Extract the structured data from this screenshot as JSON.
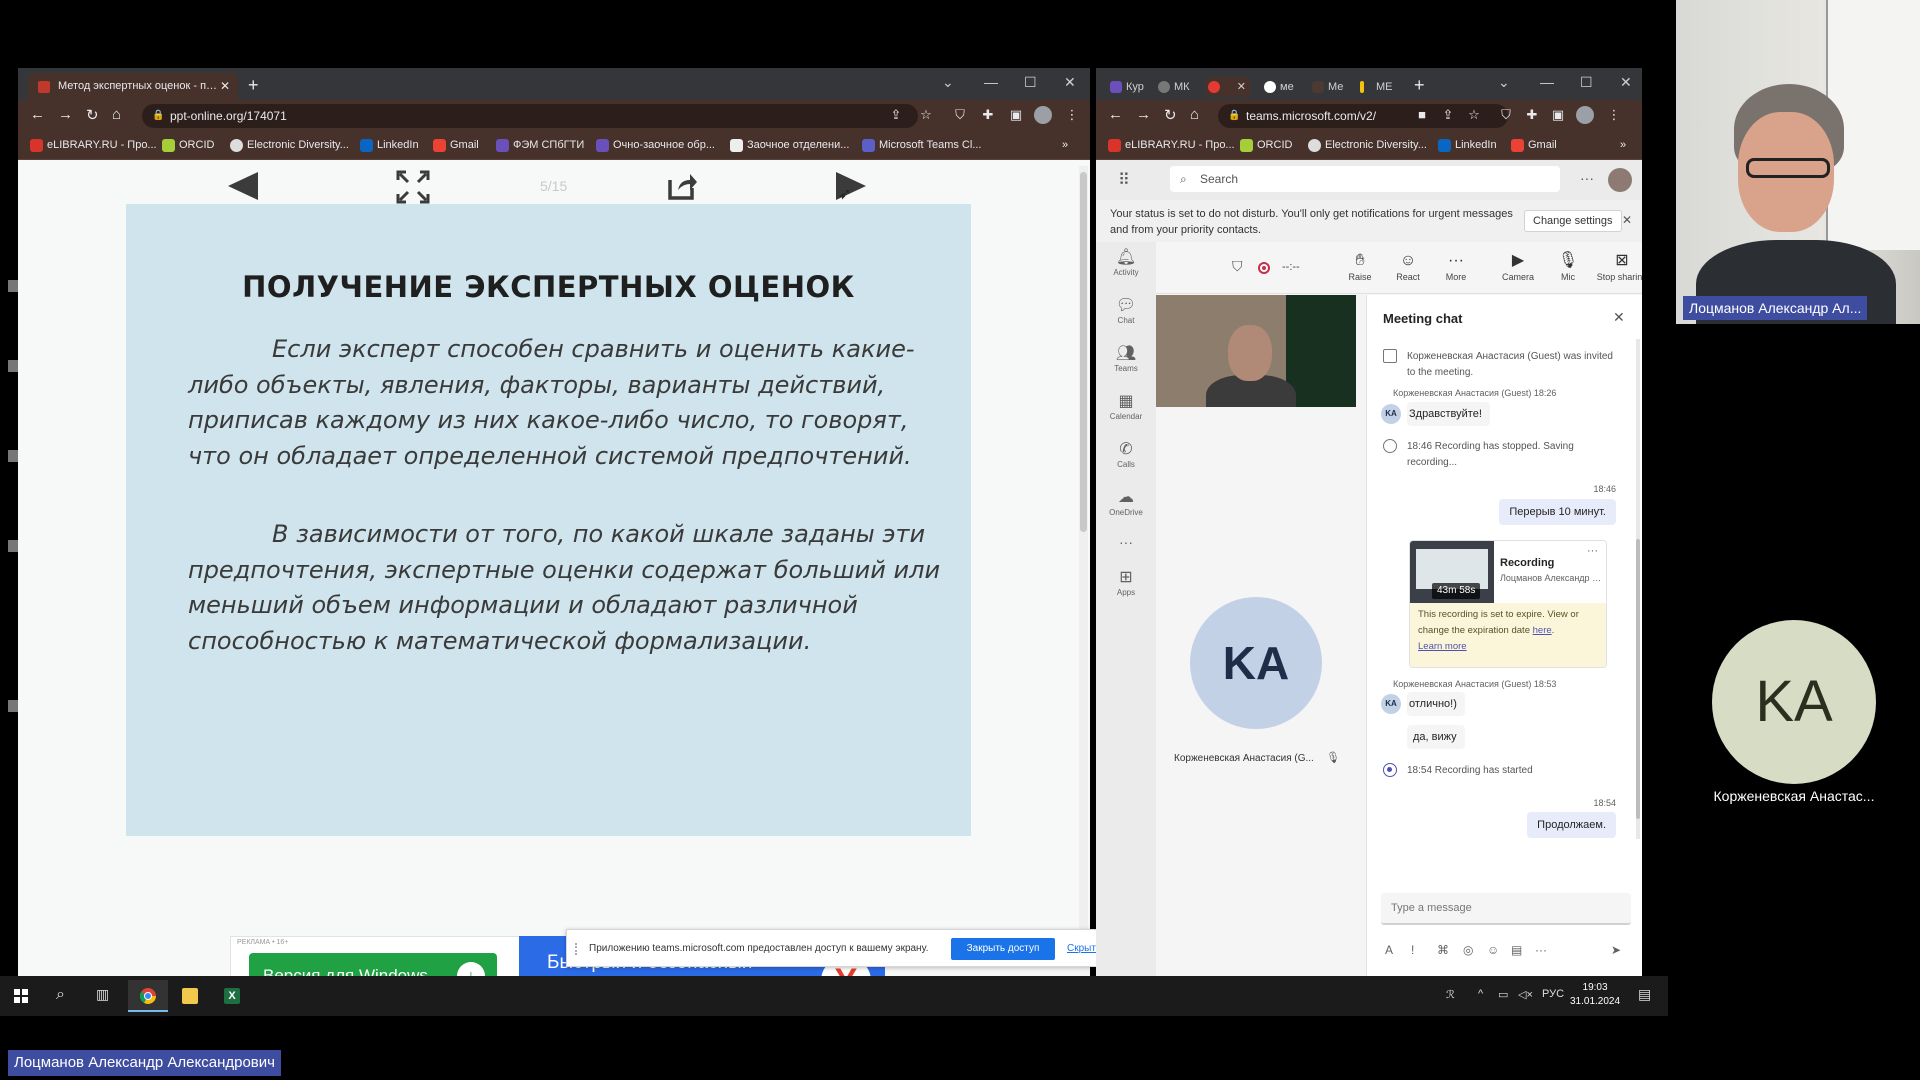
{
  "left_browser": {
    "tab_title": "Метод экспертных оценок - п…",
    "url": "ppt-online.org/174071",
    "bookmarks": [
      "eLIBRARY.RU - Про...",
      "ORCID",
      "Electronic Diversity...",
      "LinkedIn",
      "Gmail",
      "ФЭМ СПбГТИ",
      "Очно-заочное обр...",
      "Заочное отделени...",
      "Microsoft Teams Cl..."
    ],
    "bookmarks_more": "»",
    "page_counter": "5/15"
  },
  "slide": {
    "title": "ПОЛУЧЕНИЕ ЭКСПЕРТНЫХ ОЦЕНОК",
    "paragraph1": "Если эксперт способен сравнить и оценить какие-либо объекты, явления, факторы, варианты действий, приписав каждому из них какое-либо число, то говорят, что он обладает определенной системой предпочтений.",
    "paragraph2": "В зависимости от того, по какой шкале заданы эти предпочтения, экспертные оценки содержат больший или меньший объем информации и обладают различной способностью к математической формализации."
  },
  "ad": {
    "tag": "РЕКЛАМА • 16+",
    "button_label": "Версия для Windows",
    "headline": "Быстрый и безопасный браузер",
    "logo_letter": "Y",
    "info": "i"
  },
  "share_bar": {
    "text": "Приложению teams.microsoft.com предоставлен доступ к вашему экрану.",
    "stop_label": "Закрыть доступ",
    "hide_label": "Скрыть"
  },
  "right_browser": {
    "tabs": [
      "Кур",
      "МК",
      "",
      "ме",
      "Ме",
      "МЕ"
    ],
    "url": "teams.microsoft.com/v2/",
    "bookmarks": [
      "eLIBRARY.RU - Про...",
      "ORCID",
      "Electronic Diversity...",
      "LinkedIn",
      "Gmail"
    ],
    "bookmarks_more": "»"
  },
  "teams": {
    "search_placeholder": "Search",
    "dnd_text": "Your status is set to do not disturb. You'll only get notifications for urgent messages and from your priority contacts.",
    "change_settings": "Change settings",
    "rail": [
      "Activity",
      "Chat",
      "Teams",
      "Calendar",
      "Calls",
      "OneDrive",
      "Apps"
    ],
    "rail_more": "···",
    "timer": "--:--",
    "toolbar": [
      "Raise",
      "React",
      "More",
      "Camera",
      "Mic",
      "Stop sharing"
    ],
    "leave_glyph": "L",
    "participant_initials": "KA",
    "participant_name": "Корженевская Анастасия (G...",
    "chat": {
      "title": "Meeting chat",
      "invited": "Корженевская Анастасия (Guest) was invited to the meeting.",
      "msg1_meta": "Корженевская Анастасия (Guest)  18:26",
      "msg1_initials": "KA",
      "msg1": "Здравствуйте!",
      "rec_stopped": "18:46   Recording has stopped. Saving recording...",
      "out1_time": "18:46",
      "out1": "Перерыв 10 минут.",
      "recording": {
        "title": "Recording",
        "owner": "Лоцманов Александр А...",
        "duration": "43m 58s",
        "more": "···",
        "exp_text": "This recording is set to expire. View or change the expiration date",
        "exp_here": "here",
        "exp_learn": "Learn more"
      },
      "msg2_meta": "Корженевская Анастасия (Guest)  18:53",
      "msg2_initials": "KA",
      "msg2": "отлично!)",
      "msg3": "да, вижу",
      "rec_started": "18:54   Recording has started",
      "out2_time": "18:54",
      "out2": "Продолжаем.",
      "input_placeholder": "Type a message"
    }
  },
  "taskbar": {
    "lang": "РУС",
    "time": "19:03",
    "date": "31.01.2024"
  },
  "webcams": {
    "presenter_name": "Лоцманов Александр Ал...",
    "side_initials": "KA",
    "side_name": "Корженевская Анастас...",
    "bottom_name": "Лоцманов Александр Александрович"
  }
}
